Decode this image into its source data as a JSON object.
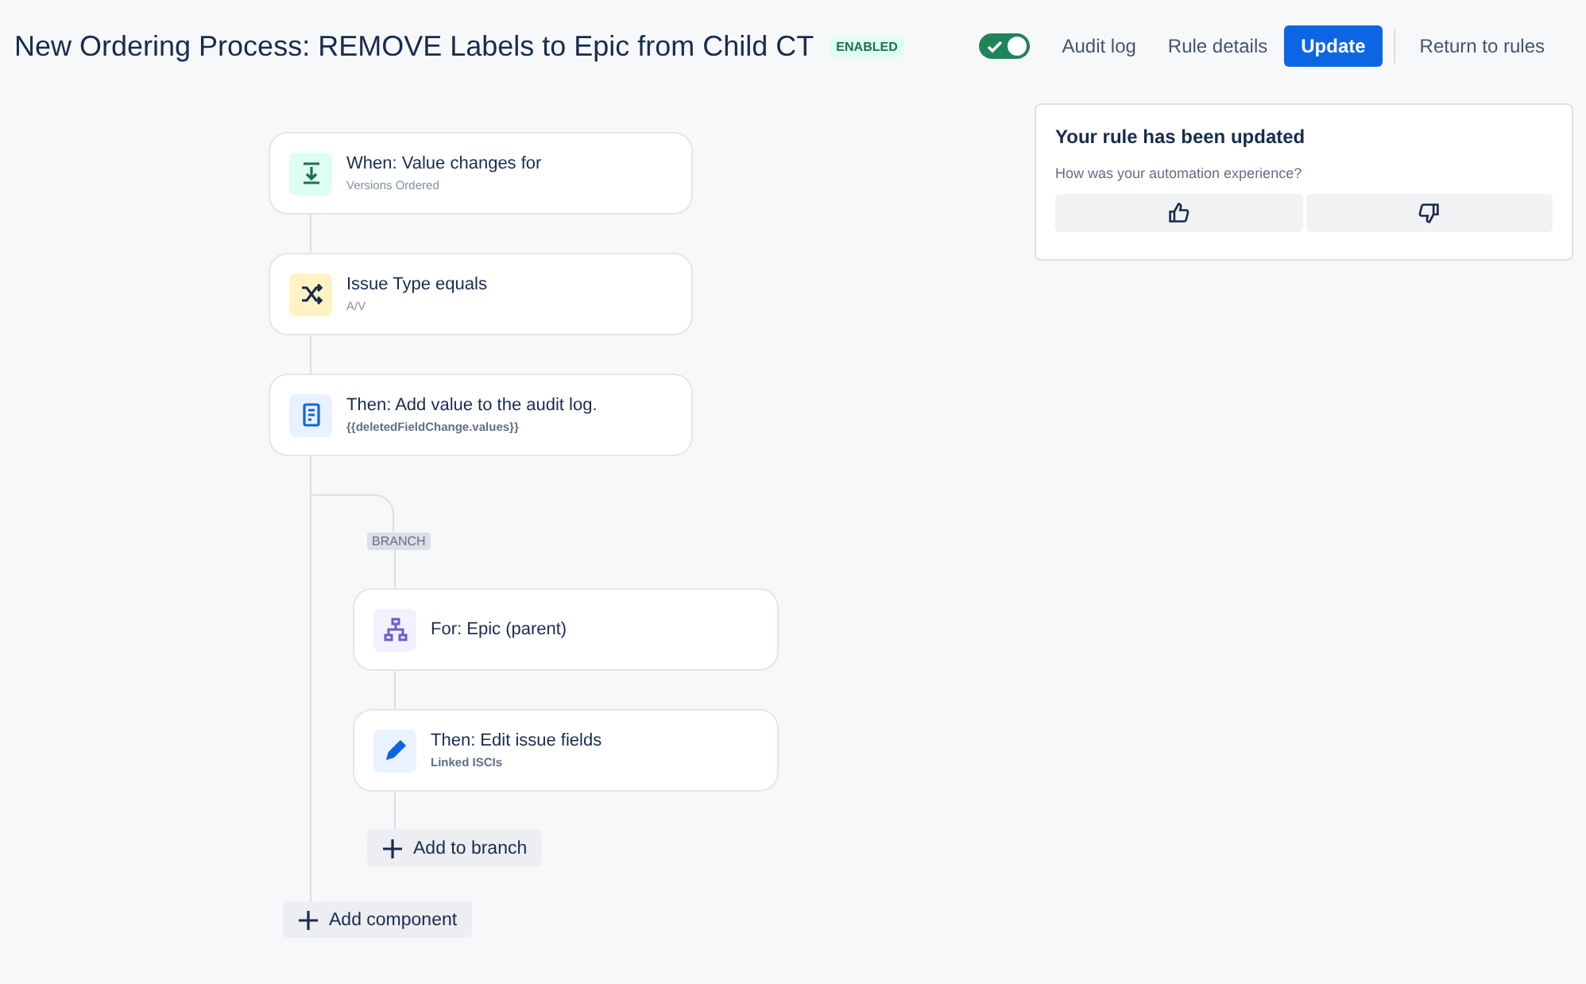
{
  "header": {
    "title": "New Ordering Process: REMOVE Labels to Epic from Child CT",
    "status_badge": "ENABLED",
    "toggle": {
      "on": true
    },
    "links": [
      "Audit log",
      "Rule details"
    ],
    "primary_button": "Update",
    "return_link": "Return to rules"
  },
  "flow": [
    {
      "kind": "trigger",
      "title": "When: Value changes for",
      "subtitle": "Versions Ordered"
    },
    {
      "kind": "condition",
      "title": "Issue Type equals",
      "subtitle": "A/V"
    },
    {
      "kind": "log",
      "title": "Then: Add value to the audit log.",
      "subtitle": "{{deletedFieldChange.values}}"
    }
  ],
  "branch": {
    "label": "BRANCH",
    "steps": [
      {
        "kind": "hierarchy",
        "title": "For: Epic (parent)"
      },
      {
        "kind": "edit",
        "title": "Then: Edit issue fields",
        "subtitle": "Linked ISCIs"
      }
    ],
    "add_button": "Add to branch"
  },
  "add_component": "Add component",
  "feedback": {
    "title": "Your rule has been updated",
    "question": "How was your automation experience?"
  }
}
